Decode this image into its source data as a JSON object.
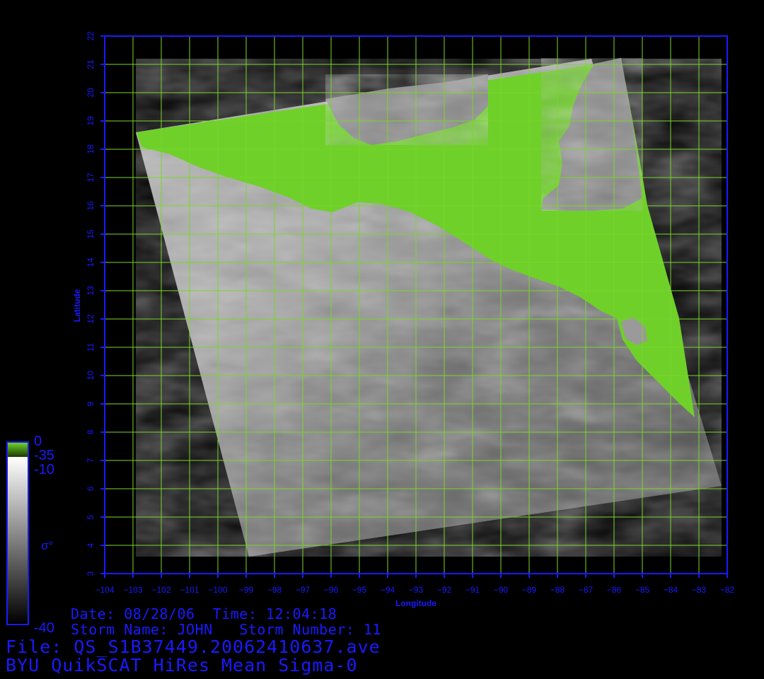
{
  "map": {
    "axes": {
      "x_title": "Longitude",
      "y_title": "Latitude",
      "x_range": [
        -104,
        -82
      ],
      "y_range": [
        3,
        22
      ],
      "x_ticks": [
        "-104",
        "-103",
        "-102",
        "-101",
        "-100",
        "-99",
        "-98",
        "-97",
        "-96",
        "-95",
        "-94",
        "-93",
        "-92",
        "-91",
        "-90",
        "-89",
        "-88",
        "-87",
        "-86",
        "-85",
        "-84",
        "-83",
        "-82"
      ],
      "y_ticks": [
        "3",
        "4",
        "5",
        "6",
        "7",
        "8",
        "9",
        "10",
        "11",
        "12",
        "13",
        "14",
        "15",
        "16",
        "17",
        "18",
        "19",
        "20",
        "21",
        "22"
      ],
      "grid": true
    },
    "swath_corners_lonlat": [
      [
        -102.9,
        18.6
      ],
      [
        -86.8,
        21.2
      ],
      [
        -82.2,
        6.1
      ],
      [
        -98.9,
        3.6
      ]
    ],
    "colors": {
      "land": "#6fd02a",
      "grid": "#7ad62a",
      "axis": "#1a1aff",
      "text": "#1a1aff",
      "background": "#000000"
    }
  },
  "colorbar": {
    "label_top": "0",
    "label_green": "-35",
    "label_white": "-10",
    "label_symbol": "σ°",
    "label_bottom": "-40"
  },
  "info": {
    "line1": "Date: 08/28/06  Time: 12:04:18",
    "line2": "Storm Name: JOHN   Storm Number: 11",
    "file": "File: QS_S1B37449.20062410637.ave",
    "product": "BYU QuikSCAT HiRes Mean Sigma-0"
  }
}
